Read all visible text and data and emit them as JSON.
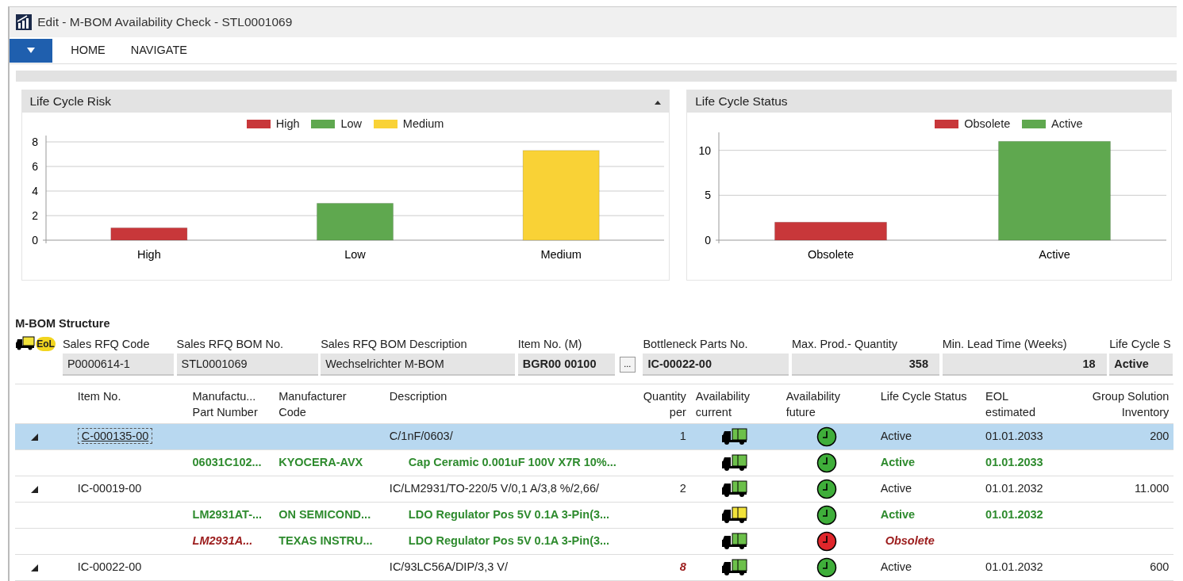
{
  "window": {
    "title": "Edit - M-BOM Availability Check - STL0001069"
  },
  "ribbon": {
    "tabs": [
      {
        "label": "HOME",
        "selected": false
      },
      {
        "label": "NAVIGATE",
        "selected": false
      }
    ]
  },
  "charts": [
    {
      "title": "Life Cycle Risk",
      "collapsible": true,
      "chart_data": {
        "type": "bar",
        "categories": [
          "High",
          "Low",
          "Medium"
        ],
        "series": [
          {
            "name": "High",
            "color": "#c8373a",
            "values": [
              1,
              null,
              null
            ]
          },
          {
            "name": "Low",
            "color": "#5fa84f",
            "values": [
              null,
              3,
              null
            ]
          },
          {
            "name": "Medium",
            "color": "#f9d236",
            "values": [
              null,
              null,
              7.3
            ]
          }
        ],
        "ylim": [
          0,
          8
        ],
        "yticks": [
          0,
          2,
          4,
          6,
          8
        ],
        "stacked": true,
        "grid": true,
        "legend": "top"
      }
    },
    {
      "title": "Life Cycle Status",
      "collapsible": false,
      "chart_data": {
        "type": "bar",
        "categories": [
          "Obsolete",
          "Active"
        ],
        "series": [
          {
            "name": "Obsolete",
            "color": "#c8373a",
            "values": [
              2,
              null
            ]
          },
          {
            "name": "Active",
            "color": "#5fa84f",
            "values": [
              null,
              11
            ]
          }
        ],
        "ylim": [
          0,
          12
        ],
        "yticks": [
          0,
          5,
          10
        ],
        "stacked": true,
        "grid": true,
        "legend": "top"
      }
    }
  ],
  "structure": {
    "title": "M-BOM Structure",
    "eol_badge": "EoL",
    "fields": [
      {
        "label": "Sales RFQ Code",
        "value": "P0000614-1",
        "bold": false,
        "numeric": false
      },
      {
        "label": "Sales RFQ BOM No.",
        "value": "STL0001069",
        "bold": false,
        "numeric": false
      },
      {
        "label": "Sales RFQ BOM Description",
        "value": "Wechselrichter M-BOM",
        "bold": false,
        "numeric": false
      },
      {
        "label": "Item No. (M)",
        "value": "BGR00 00100",
        "bold": true,
        "numeric": false,
        "lookup": "..."
      },
      {
        "label": "Bottleneck Parts No.",
        "value": "IC-00022-00",
        "bold": true,
        "numeric": false
      },
      {
        "label": "Max. Prod.- Quantity",
        "value": "358",
        "bold": true,
        "numeric": true
      },
      {
        "label": "Min. Lead Time (Weeks)",
        "value": "18",
        "bold": true,
        "numeric": true
      },
      {
        "label": "Life Cycle S",
        "value": "Active",
        "bold": true,
        "numeric": false
      }
    ]
  },
  "table": {
    "columns": [
      {
        "line1": "Item No.",
        "numeric": false
      },
      {
        "line1": "Manufactu...",
        "line2": "Part Number",
        "numeric": false
      },
      {
        "line1": "Manufacturer",
        "line2": "Code",
        "numeric": false
      },
      {
        "line1": "Description",
        "numeric": false
      },
      {
        "line1": "Quantity",
        "line2": "per",
        "numeric": true
      },
      {
        "line1": "Availability",
        "line2": "current",
        "numeric": false
      },
      {
        "line1": "Availability",
        "line2": "future",
        "numeric": false
      },
      {
        "line1": "Life Cycle Status",
        "numeric": false
      },
      {
        "line1": "EOL",
        "line2": "estimated",
        "numeric": false
      },
      {
        "line1": "Group Solution",
        "line2": "Inventory",
        "numeric": true
      }
    ],
    "rows": [
      {
        "kind": "item",
        "selected": true,
        "expanded": true,
        "bottleneck": false,
        "item_no": "C-000135-00",
        "description": "C/1nF/0603/",
        "quantity": "1",
        "current": {
          "color": "#6cc04a"
        },
        "future": {
          "color": "#3fae3a"
        },
        "status": "Active",
        "eol": "01.01.2033",
        "inventory": "200"
      },
      {
        "kind": "source",
        "selected": false,
        "obsolete": false,
        "part_number": "06031C102...",
        "manufacturer": "KYOCERA-AVX",
        "description": "Cap Ceramic 0.001uF 100V X7R 10%...",
        "current": {
          "color": "#6cc04a"
        },
        "future": {
          "color": "#3fae3a"
        },
        "status": "Active",
        "eol": "01.01.2033"
      },
      {
        "kind": "item",
        "selected": false,
        "expanded": true,
        "bottleneck": false,
        "item_no": "IC-00019-00",
        "description": "IC/LM2931/TO-220/5 V/0,1 A/3,8 %/2,66/",
        "quantity": "2",
        "current": {
          "color": "#6cc04a"
        },
        "future": {
          "color": "#3fae3a"
        },
        "status": "Active",
        "eol": "01.01.2032",
        "inventory": "11.000"
      },
      {
        "kind": "source",
        "selected": false,
        "obsolete": false,
        "part_number": "LM2931AT-...",
        "manufacturer": "ON SEMICOND...",
        "description": "LDO Regulator Pos 5V 0.1A 3-Pin(3...",
        "current": {
          "color": "#f2e33a"
        },
        "future": {
          "color": "#3fae3a"
        },
        "status": "Active",
        "eol": "01.01.2032"
      },
      {
        "kind": "source",
        "selected": false,
        "obsolete": true,
        "part_number": "LM2931A...",
        "manufacturer": "TEXAS INSTRU...",
        "description": "LDO Regulator Pos 5V 0.1A 3-Pin(3...",
        "current": {
          "color": "#6cc04a"
        },
        "future": {
          "color": "#e0262b"
        },
        "status": "Obsolete"
      },
      {
        "kind": "item",
        "selected": false,
        "expanded": true,
        "bottleneck": true,
        "item_no": "IC-00022-00",
        "description": "IC/93LC56A/DIP/3,3 V/",
        "quantity": "8",
        "current": {
          "color": "#6cc04a"
        },
        "future": {
          "color": "#3fae3a"
        },
        "status": "Active",
        "eol": "01.01.2032",
        "inventory": "600"
      }
    ]
  }
}
